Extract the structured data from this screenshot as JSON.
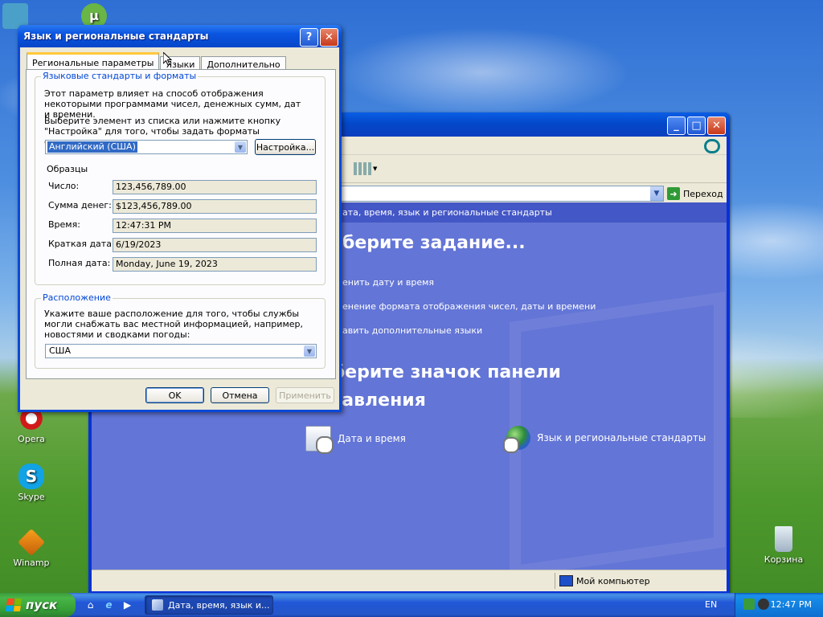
{
  "desktop": {
    "icons": [
      {
        "label": "Opera",
        "icon": "opera-icon"
      },
      {
        "label": "Skype",
        "icon": "skype-icon"
      },
      {
        "label": "Winamp",
        "icon": "winamp-icon"
      },
      {
        "label": "Корзина",
        "icon": "recycle-bin-icon"
      }
    ]
  },
  "control_panel": {
    "title": "Дата, время, язык и региональные стандарты",
    "go_label": "Переход",
    "breadcrumb": "ата, время, язык и региональные стандарты",
    "pick_task": "берите задание...",
    "tasks": [
      "енить дату и время",
      "енение формата отображения чисел, даты и времени",
      "авить дополнительные языки"
    ],
    "or_pick_icon": "выберите значок панели управления",
    "icon_items": [
      {
        "label": "Дата и время",
        "icon": "clock-calendar-icon"
      },
      {
        "label": "Язык и региональные стандарты",
        "icon": "globe-icon"
      }
    ],
    "status_text": "Мой компьютер"
  },
  "dialog": {
    "title": "Язык и региональные стандарты",
    "tabs": [
      "Региональные параметры",
      "Языки",
      "Дополнительно"
    ],
    "active_tab": 0,
    "formats_group": {
      "title": "Языковые стандарты и форматы",
      "desc": "Этот параметр влияет на способ отображения некоторыми программами чисел, денежных сумм, дат и времени.",
      "instruction": "Выберите элемент из списка или нажмите кнопку \"Настройка\" для того, чтобы задать форматы самостоятельно:",
      "locale_value": "Английский (США)",
      "customize_label": "Настройка...",
      "samples_label": "Образцы",
      "samples": [
        {
          "label": "Число:",
          "value": "123,456,789.00"
        },
        {
          "label": "Сумма денег:",
          "value": "$123,456,789.00"
        },
        {
          "label": "Время:",
          "value": "12:47:31 PM"
        },
        {
          "label": "Краткая дата:",
          "value": "6/19/2023"
        },
        {
          "label": "Полная дата:",
          "value": "Monday, June 19, 2023"
        }
      ]
    },
    "location_group": {
      "title": "Расположение",
      "desc": "Укажите ваше расположение для того, чтобы службы могли снабжать вас местной информацией, например, новостями и сводками погоды:",
      "value": "США"
    },
    "buttons": {
      "ok": "OK",
      "cancel": "Отмена",
      "apply": "Применить"
    }
  },
  "taskbar": {
    "start_label": "пуск",
    "task_label": "Дата, время, язык и...",
    "language": "EN",
    "clock": "12:47 PM"
  }
}
